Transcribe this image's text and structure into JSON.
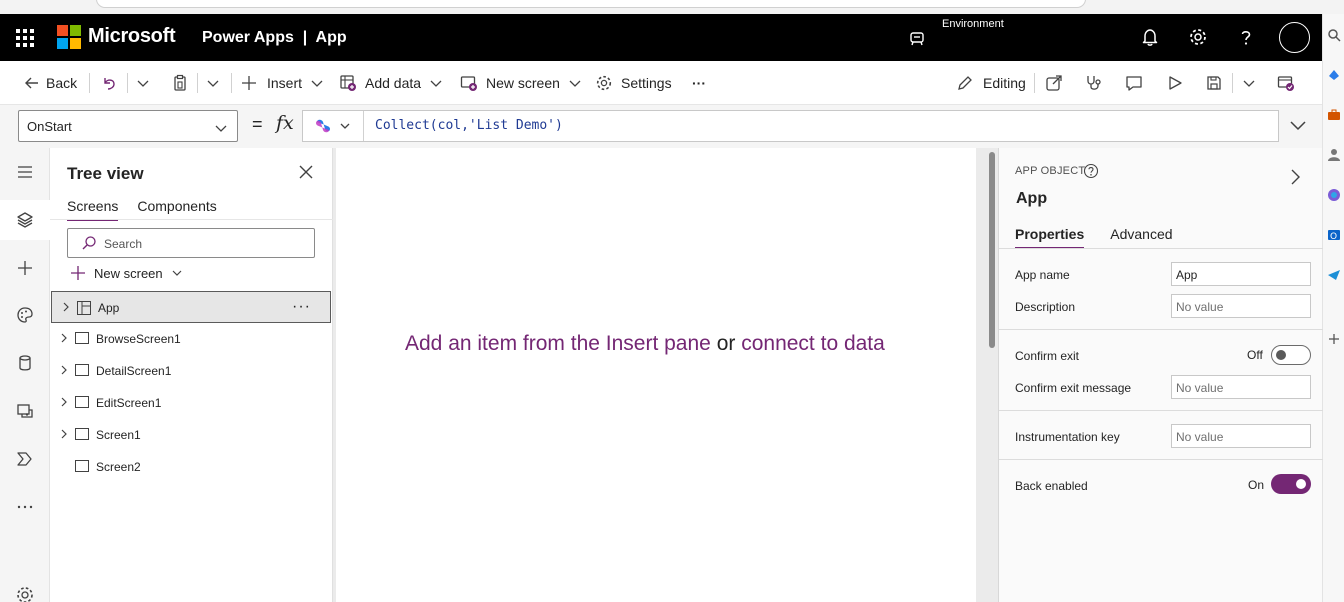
{
  "header": {
    "brand": "Microsoft",
    "app_title": "Power Apps  |  App",
    "environment_label": "Environment"
  },
  "commands": {
    "back": "Back",
    "insert": "Insert",
    "add_data": "Add data",
    "new_screen": "New screen",
    "settings": "Settings",
    "more": "···",
    "editing": "Editing"
  },
  "formula": {
    "property": "OnStart",
    "equals": "=",
    "fx": "fx",
    "expression": "Collect(col,'List Demo')"
  },
  "tree": {
    "title": "Tree view",
    "tabs": [
      "Screens",
      "Components"
    ],
    "search_placeholder": "Search",
    "new_screen": "New screen",
    "items": [
      {
        "label": "App",
        "selected": true,
        "expandable": true
      },
      {
        "label": "BrowseScreen1",
        "expandable": true
      },
      {
        "label": "DetailScreen1",
        "expandable": true
      },
      {
        "label": "EditScreen1",
        "expandable": true
      },
      {
        "label": "Screen1",
        "expandable": true
      },
      {
        "label": "Screen2",
        "expandable": false
      }
    ],
    "more": "···"
  },
  "canvas": {
    "msg_part1": "Add an item from the Insert pane",
    "msg_or": "or",
    "msg_part2": "connect to data"
  },
  "properties": {
    "kicker": "APP OBJECT",
    "title": "App",
    "tabs": [
      "Properties",
      "Advanced"
    ],
    "app_name_label": "App name",
    "app_name_value": "App",
    "description_label": "Description",
    "description_placeholder": "No value",
    "confirm_exit_label": "Confirm exit",
    "confirm_exit_state": "Off",
    "confirm_exit_msg_label": "Confirm exit message",
    "confirm_exit_msg_placeholder": "No value",
    "instrumentation_label": "Instrumentation key",
    "instrumentation_placeholder": "No value",
    "back_enabled_label": "Back enabled",
    "back_enabled_state": "On"
  },
  "colors": {
    "accent": "#742774",
    "topbar": "#000000",
    "ms_red": "#f25022",
    "ms_green": "#7fba00",
    "ms_blue": "#00a4ef",
    "ms_yellow": "#ffb900"
  }
}
